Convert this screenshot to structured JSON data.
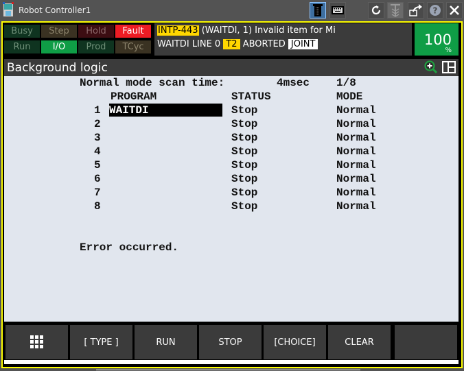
{
  "window": {
    "title": "Robot Controller1",
    "toolbar_icons": [
      "teach-pendant-icon",
      "keyboard-icon",
      "refresh-icon",
      "robot-icon",
      "share-icon",
      "help-icon",
      "close-icon"
    ]
  },
  "status_indicators": {
    "busy": "Busy",
    "step": "Step",
    "hold": "Hold",
    "fault": "Fault",
    "run": "Run",
    "io": "I/O",
    "prod": "Prod",
    "tcyc": "TCyc"
  },
  "alarm": {
    "code": "INTP-443",
    "message": " (WAITDI, 1) Invalid item for Mi",
    "program_line": "WAITDI LINE 0 ",
    "mode_badge": "T2",
    "state": " ABORTED ",
    "coord_badge": "JOINT",
    "colors": {
      "code_bg": "#ffd700",
      "t2_bg": "#ffd700"
    }
  },
  "override": {
    "value": "100",
    "unit": "%",
    "color": "#0f9d46"
  },
  "screen": {
    "title": "Background logic",
    "scan_label": "Normal mode scan time:",
    "scan_value": "4msec",
    "page": "1/8",
    "headers": {
      "program": "PROGRAM",
      "status": "STATUS",
      "mode": "MODE"
    },
    "rows": [
      {
        "num": "1",
        "program": "WAITDI",
        "status": "Stop",
        "mode": "Normal"
      },
      {
        "num": "2",
        "program": "",
        "status": "Stop",
        "mode": "Normal"
      },
      {
        "num": "3",
        "program": "",
        "status": "Stop",
        "mode": "Normal"
      },
      {
        "num": "4",
        "program": "",
        "status": "Stop",
        "mode": "Normal"
      },
      {
        "num": "5",
        "program": "",
        "status": "Stop",
        "mode": "Normal"
      },
      {
        "num": "6",
        "program": "",
        "status": "Stop",
        "mode": "Normal"
      },
      {
        "num": "7",
        "program": "",
        "status": "Stop",
        "mode": "Normal"
      },
      {
        "num": "8",
        "program": "",
        "status": "Stop",
        "mode": "Normal"
      }
    ],
    "message": "Error occurred."
  },
  "function_keys": {
    "menu_icon": "grid-menu-icon",
    "f1": "[ TYPE ]",
    "f2": "RUN",
    "f3": "STOP",
    "f4": "[CHOICE]",
    "f5": "CLEAR",
    "f6": ""
  }
}
